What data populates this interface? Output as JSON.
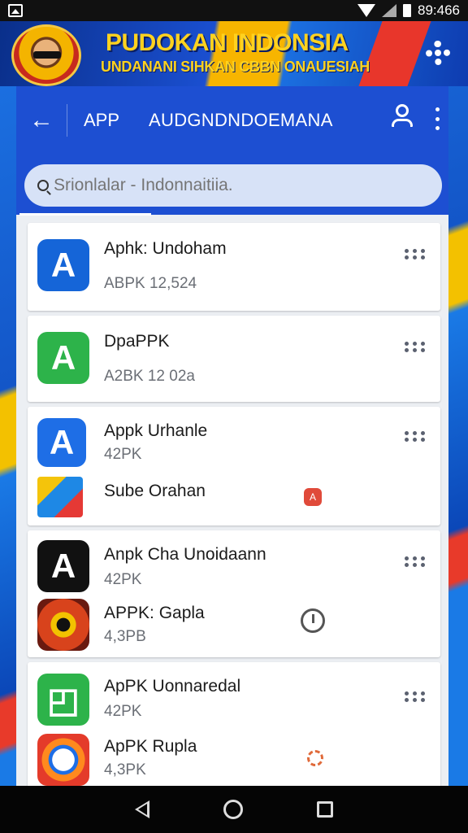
{
  "status_bar": {
    "time": "89:466"
  },
  "banner": {
    "title": "PUDOKAN INDONSIA",
    "subtitle": "UNDANANI SIHKAN CBBN ONAUESIAH"
  },
  "app_bar": {
    "tab_app": "APP",
    "title": "AUDGNDNDOEMANA"
  },
  "search": {
    "placeholder": "Srionlalar - Indonnaitiia."
  },
  "apps": [
    {
      "name": "Aphk: Undoham",
      "meta": "ABPK  12,524",
      "icon": "blue-a-icon",
      "color": "#1565d8"
    },
    {
      "name": "DpaPPK",
      "meta": "A2BK  12 02a",
      "icon": "green-a-icon",
      "color": "#2db34a"
    },
    {
      "name": "Apрk Urhanle",
      "meta": "42PK",
      "icon": "blue-a-icon",
      "color": "#1e6ee6"
    },
    {
      "name": "Sube Orahan",
      "meta": "",
      "icon": "play-store-icon",
      "color": "#ffffff"
    },
    {
      "name": "Anpk Cha Unoidaann",
      "meta": "42PK",
      "icon": "black-a-icon",
      "color": "#111111"
    },
    {
      "name": "APPK: Gapla",
      "meta": "4,3PB",
      "icon": "target-icon",
      "color": "#d8431c"
    },
    {
      "name": "ApPK Uonnaredal",
      "meta": "42PK",
      "icon": "green-frame-icon",
      "color": "#2db34a"
    },
    {
      "name": "ApPK Rupla",
      "meta": "4,3PK",
      "icon": "red-ring-icon",
      "color": "#e43b2a"
    }
  ]
}
